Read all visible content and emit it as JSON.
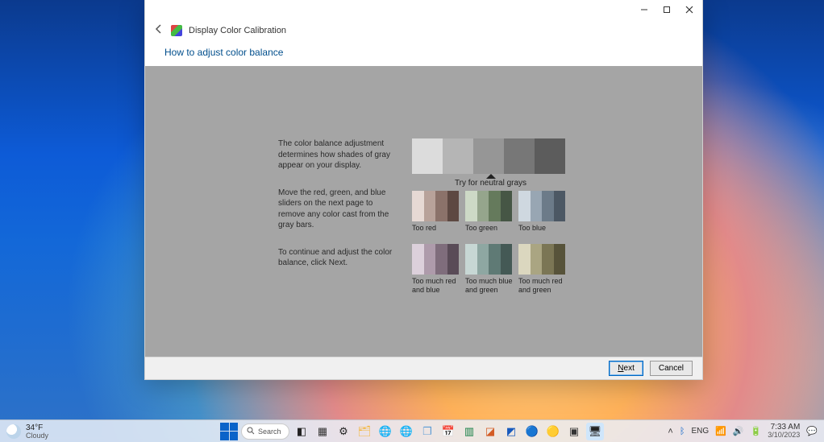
{
  "window": {
    "app_name": "Display Color Calibration",
    "subheading": "How to adjust color balance",
    "paragraph1": "The color balance adjustment determines how shades of gray appear on your display.",
    "paragraph2": "Move the red, green, and blue sliders on the next page to remove any color cast from the gray bars.",
    "paragraph3": "To continue and adjust the color balance, click Next.",
    "try_label": "Try for neutral grays",
    "cast_labels": {
      "too_red": "Too red",
      "too_green": "Too green",
      "too_blue": "Too blue",
      "too_rb": "Too much red and blue",
      "too_bg": "Too much blue and green",
      "too_rg": "Too much red and green"
    },
    "buttons": {
      "next": "Next",
      "cancel": "Cancel"
    }
  },
  "taskbar": {
    "weather_temp": "34°F",
    "weather_desc": "Cloudy",
    "search_label": "Search",
    "lang": "ENG",
    "time": "7:33 AM",
    "date": "3/10/2023"
  }
}
